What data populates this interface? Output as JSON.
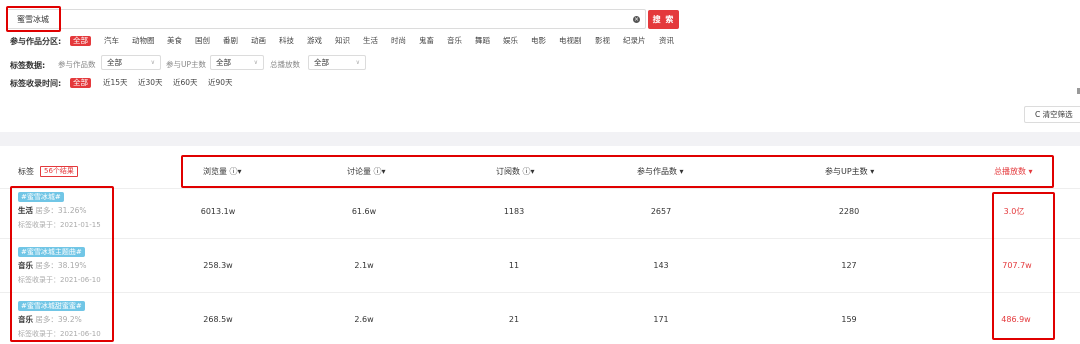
{
  "search": {
    "value": "蜜雪冰城",
    "clear_icon": "×",
    "button_label": "搜 索"
  },
  "filters": {
    "category_label": "参与作品分区:",
    "categories": [
      "全部",
      "汽车",
      "动物圈",
      "美食",
      "国创",
      "番剧",
      "动画",
      "科技",
      "游戏",
      "知识",
      "生活",
      "时尚",
      "鬼畜",
      "音乐",
      "舞蹈",
      "娱乐",
      "电影",
      "电视剧",
      "影视",
      "纪录片",
      "资讯"
    ],
    "data_label": "标签数据:",
    "data_filters": [
      {
        "label": "参与作品数",
        "value": "全部"
      },
      {
        "label": "参与UP主数",
        "value": "全部"
      },
      {
        "label": "总播放数",
        "value": "全部"
      }
    ],
    "time_label": "标签收录时间:",
    "time_options": [
      "全部",
      "近15天",
      "近30天",
      "近60天",
      "近90天"
    ],
    "reset_label": "C 清空筛选"
  },
  "table": {
    "tag_header": "标签",
    "result_count": "56个结果",
    "columns": [
      "浏览量 ⓘ▾",
      "讨论量 ⓘ▾",
      "订阅数 ⓘ▾",
      "参与作品数 ▾",
      "参与UP主数 ▾",
      "总播放数 ▾"
    ],
    "rows": [
      {
        "tag": "#蜜雪冰城#",
        "zone": "生活",
        "pct": "居多：31.26%",
        "date": "标签收录于：2021-01-15",
        "views": "6013.1w",
        "discussions": "61.6w",
        "subscriptions": "1183",
        "works": "2657",
        "uploaders": "2280",
        "plays": "3.0亿"
      },
      {
        "tag": "#蜜雪冰城主题曲#",
        "zone": "音乐",
        "pct": "居多：38.19%",
        "date": "标签收录于：2021-06-10",
        "views": "258.3w",
        "discussions": "2.1w",
        "subscriptions": "11",
        "works": "143",
        "uploaders": "127",
        "plays": "707.7w"
      },
      {
        "tag": "#蜜雪冰城甜蜜蜜#",
        "zone": "音乐",
        "pct": "居多：39.2%",
        "date": "标签收录于：2021-06-10",
        "views": "268.5w",
        "discussions": "2.6w",
        "subscriptions": "21",
        "works": "171",
        "uploaders": "159",
        "plays": "486.9w"
      }
    ]
  },
  "colors": {
    "accent": "#e4393c",
    "annotation": "#e00000",
    "tag_pill": "#71c6e6"
  }
}
